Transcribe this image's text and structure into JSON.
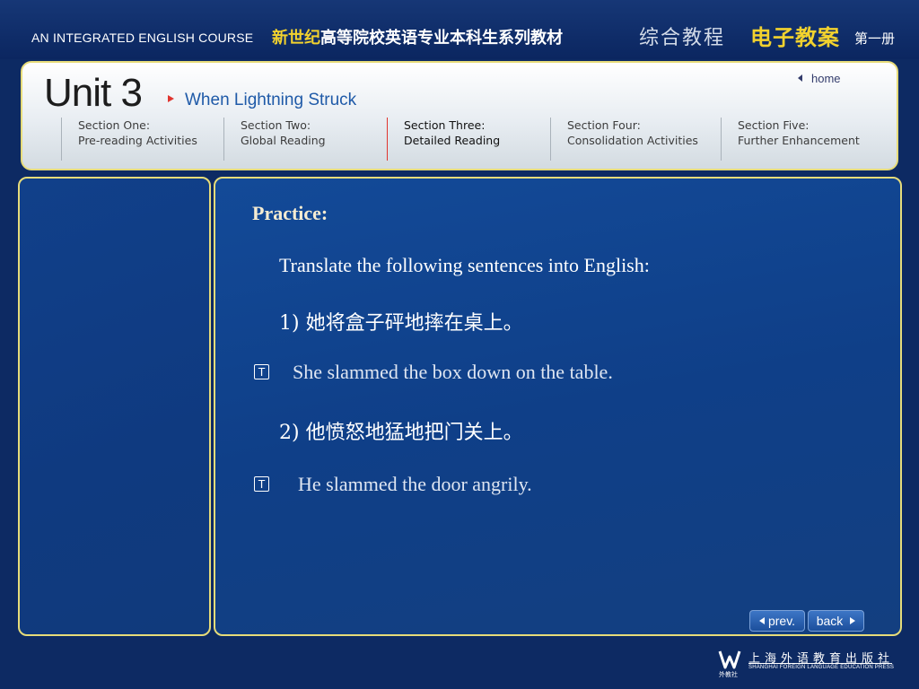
{
  "top_banner": {
    "course": "AN INTEGRATED ENGLISH COURSE",
    "series_yellow": "新世纪",
    "series_white": "高等院校英语专业本科生系列教材",
    "zonghe": "综合教程",
    "dianzi": "电子教案",
    "volume": "第一册"
  },
  "header": {
    "unit": "Unit 3",
    "subtitle": "When Lightning Struck",
    "home": "home"
  },
  "sections": [
    {
      "line1": "Section One:",
      "line2": "Pre-reading Activities",
      "active": false
    },
    {
      "line1": "Section Two:",
      "line2": "Global Reading",
      "active": false
    },
    {
      "line1": "Section Three:",
      "line2": "Detailed Reading",
      "active": true
    },
    {
      "line1": "Section Four:",
      "line2": "Consolidation Activities",
      "active": false
    },
    {
      "line1": "Section Five:",
      "line2": "Further Enhancement",
      "active": false
    }
  ],
  "content": {
    "heading": "Practice:",
    "instruction": "Translate the following sentences into English:",
    "items": [
      {
        "question": "1) 她将盒子砰地摔在桌上。",
        "answer": "She slammed the box down on the table."
      },
      {
        "question": "2) 他愤怒地猛地把门关上。",
        "answer": "He slammed the door angrily."
      }
    ],
    "toggle_label": "T"
  },
  "nav": {
    "prev": "prev.",
    "back": "back"
  },
  "publisher": {
    "cn": "上海外语教育出版社",
    "en": "SHANGHAI FOREIGN LANGUAGE EDUCATION PRESS",
    "logo_caption": "外教社"
  },
  "colors": {
    "background": "#0d2a63",
    "panel_border": "#e7dc79",
    "accent_yellow": "#f2d22e",
    "accent_red": "#e0352f",
    "link_blue": "#1f5aa8"
  }
}
